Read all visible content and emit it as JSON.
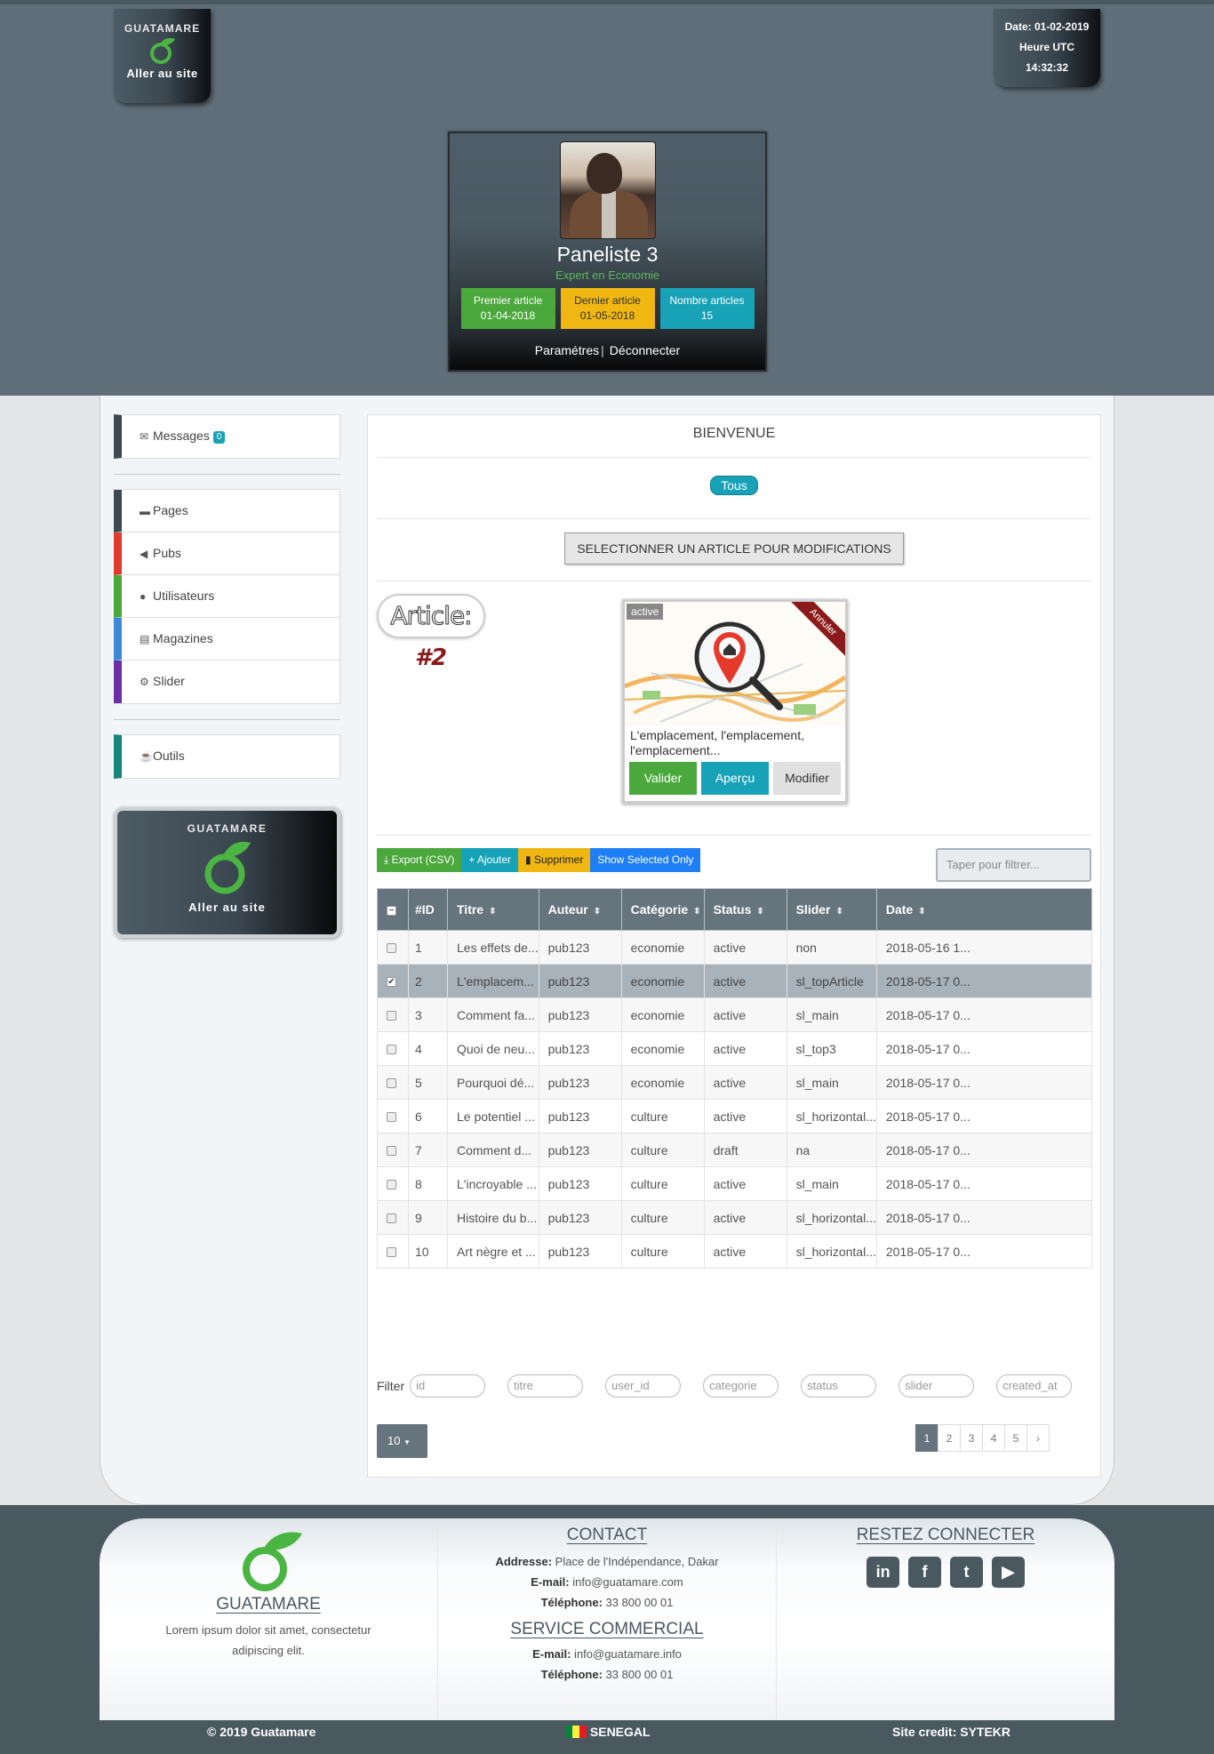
{
  "header": {
    "logo_brand": "GUATAMARE",
    "logo_link": "Aller au site",
    "date": "Date: 01-02-2019",
    "utc_label": "Heure UTC",
    "time": "14:32:32"
  },
  "profile": {
    "name": "Paneliste 3",
    "role": "Expert en Economie",
    "stats": [
      {
        "label": "Premier article",
        "value": "01-04-2018"
      },
      {
        "label": "Dernier article",
        "value": "01-05-2018"
      },
      {
        "label": "Nombre articles",
        "value": "15"
      }
    ],
    "settings": "Paramétres",
    "logout": "Déconnecter"
  },
  "sidebar": {
    "messages": {
      "label": "Messages",
      "count": "0"
    },
    "items": [
      {
        "label": "Pages",
        "color": "#3e4a52"
      },
      {
        "label": "Pubs",
        "color": "#e03a2c"
      },
      {
        "label": "Utilisateurs",
        "color": "#4ba83c"
      },
      {
        "label": "Magazines",
        "color": "#3a8ad6"
      },
      {
        "label": "Slider",
        "color": "#6a2fa6"
      }
    ],
    "tools": "Outils",
    "banner_brand": "GUATAMARE",
    "banner_link": "Aller au site"
  },
  "main": {
    "welcome": "BIENVENUE",
    "filter_all": "Tous",
    "select_button": "SELECTIONNER UN ARTICLE POUR MODIFICATIONS",
    "article_label": "Article:",
    "article_number": "#2",
    "card": {
      "status": "active",
      "ribbon": "Annuler",
      "text": "L'emplacement, l'emplacement, l'emplacement...",
      "validate": "Valider",
      "preview": "Aperçu",
      "edit": "Modifier"
    }
  },
  "toolbar": {
    "export": "Export (CSV)",
    "add": "Ajouter",
    "delete": "Supprimer",
    "show_selected": "Show Selected Only",
    "filter_placeholder": "Taper pour filtrer..."
  },
  "table": {
    "headers": [
      "#ID",
      "Titre",
      "Auteur",
      "Catégorie",
      "Status",
      "Slider",
      "Date"
    ],
    "rows": [
      {
        "id": "1",
        "titre": "Les effets de...",
        "auteur": "pub123",
        "categorie": "economie",
        "status": "active",
        "slider": "non",
        "date": "2018-05-16 1...",
        "checked": false
      },
      {
        "id": "2",
        "titre": "L'emplacem...",
        "auteur": "pub123",
        "categorie": "economie",
        "status": "active",
        "slider": "sl_topArticle",
        "date": "2018-05-17 0...",
        "checked": true
      },
      {
        "id": "3",
        "titre": "Comment fa...",
        "auteur": "pub123",
        "categorie": "economie",
        "status": "active",
        "slider": "sl_main",
        "date": "2018-05-17 0...",
        "checked": false
      },
      {
        "id": "4",
        "titre": "Quoi de neu...",
        "auteur": "pub123",
        "categorie": "economie",
        "status": "active",
        "slider": "sl_top3",
        "date": "2018-05-17 0...",
        "checked": false
      },
      {
        "id": "5",
        "titre": "Pourquoi dé...",
        "auteur": "pub123",
        "categorie": "economie",
        "status": "active",
        "slider": "sl_main",
        "date": "2018-05-17 0...",
        "checked": false
      },
      {
        "id": "6",
        "titre": "Le potentiel ...",
        "auteur": "pub123",
        "categorie": "culture",
        "status": "active",
        "slider": "sl_horizontal...",
        "date": "2018-05-17 0...",
        "checked": false
      },
      {
        "id": "7",
        "titre": "Comment d...",
        "auteur": "pub123",
        "categorie": "culture",
        "status": "draft",
        "slider": "na",
        "date": "2018-05-17 0...",
        "checked": false
      },
      {
        "id": "8",
        "titre": "L'incroyable ...",
        "auteur": "pub123",
        "categorie": "culture",
        "status": "active",
        "slider": "sl_main",
        "date": "2018-05-17 0...",
        "checked": false
      },
      {
        "id": "9",
        "titre": "Histoire du b...",
        "auteur": "pub123",
        "categorie": "culture",
        "status": "active",
        "slider": "sl_horizontal...",
        "date": "2018-05-17 0...",
        "checked": false
      },
      {
        "id": "10",
        "titre": "Art nègre et ...",
        "auteur": "pub123",
        "categorie": "culture",
        "status": "active",
        "slider": "sl_horizontal...",
        "date": "2018-05-17 0...",
        "checked": false
      }
    ],
    "filter_label": "Filter",
    "column_filters": [
      "id",
      "titre",
      "user_id",
      "categorie",
      "status",
      "slider",
      "created_at"
    ],
    "per_page": "10",
    "pages": [
      "1",
      "2",
      "3",
      "4",
      "5",
      "›"
    ]
  },
  "footer": {
    "brand": "GUATAMARE",
    "lorem": "Lorem ipsum dolor sit amet, consectetur adipiscing elit.",
    "contact_title": "CONTACT",
    "address_label": "Addresse:",
    "address": "Place de l'Indépendance, Dakar",
    "email_label": "E-mail:",
    "email": "info@guatamare.com",
    "phone_label": "Téléphone:",
    "phone": "33 800 00 01",
    "commercial_title": "SERVICE COMMERCIAL",
    "commercial_email": "info@guatamare.info",
    "commercial_phone": "33 800 00 01",
    "social_title": "RESTEZ CONNECTER",
    "social": [
      "linkedin-icon",
      "facebook-icon",
      "twitter-icon",
      "youtube-icon"
    ],
    "copyright": "© 2019 Guatamare",
    "country": "SENEGAL",
    "credit": "Site credit: SYTEKR"
  }
}
